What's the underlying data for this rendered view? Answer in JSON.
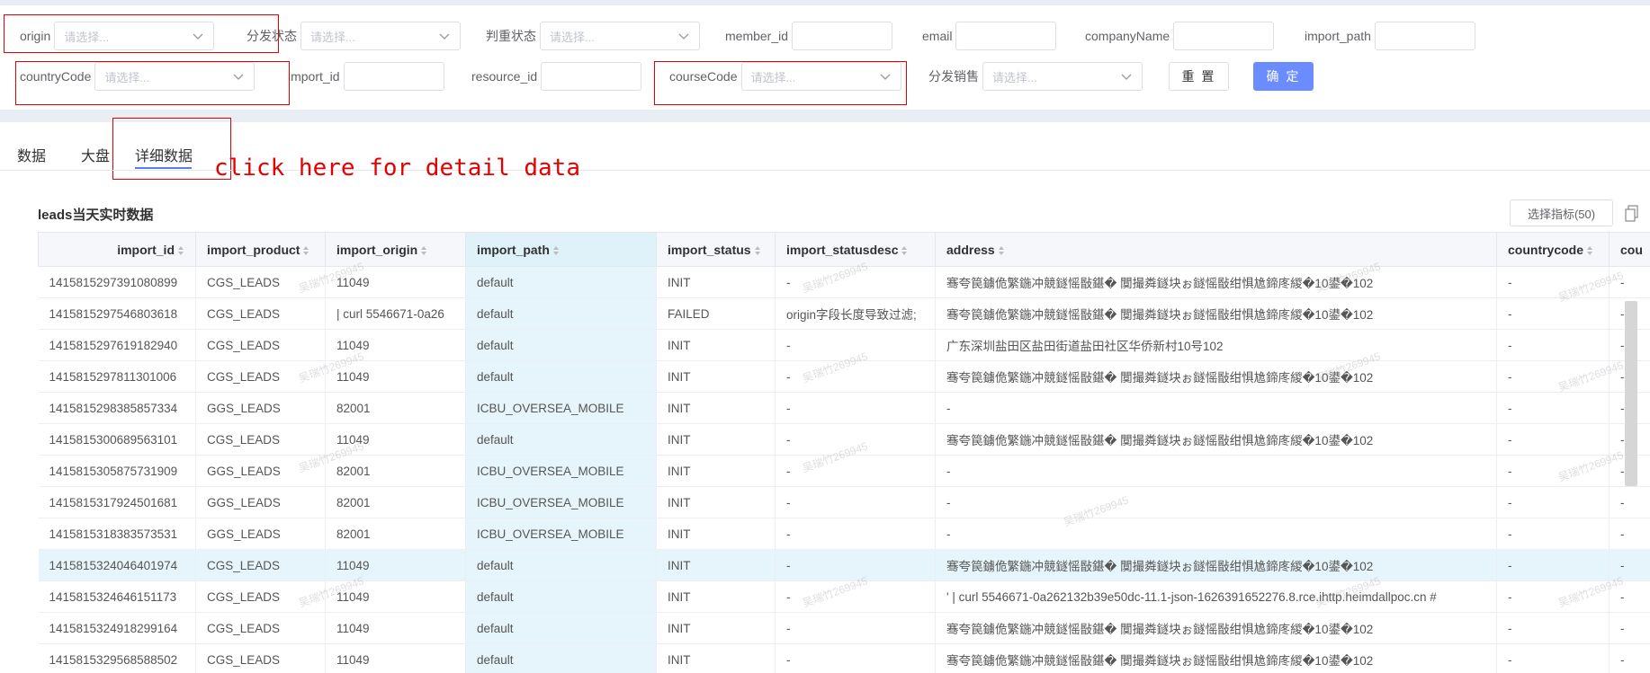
{
  "filters": {
    "origin": {
      "label": "origin",
      "placeholder": "请选择..."
    },
    "dispatch_status": {
      "label": "分发状态",
      "placeholder": "请选择..."
    },
    "judge_status": {
      "label": "判重状态",
      "placeholder": "请选择..."
    },
    "member_id": {
      "label": "member_id",
      "value": ""
    },
    "email": {
      "label": "email",
      "value": ""
    },
    "companyName": {
      "label": "companyName",
      "value": ""
    },
    "import_path": {
      "label": "import_path",
      "value": ""
    },
    "countryCode": {
      "label": "countryCode",
      "placeholder": "请选择..."
    },
    "import_id": {
      "label": "import_id",
      "value": ""
    },
    "resource_id": {
      "label": "resource_id",
      "value": ""
    },
    "courseCode": {
      "label": "courseCode",
      "placeholder": "请选择..."
    },
    "dispatch_sales": {
      "label": "分发销售",
      "placeholder": "请选择..."
    },
    "reset_label": "重 置",
    "confirm_label": "确 定"
  },
  "tabs": [
    {
      "label": "数据"
    },
    {
      "label": "大盘"
    },
    {
      "label": "详细数据",
      "active": true
    }
  ],
  "annotation": "click here for detail data",
  "table": {
    "title": "leads当天实时数据",
    "select_metrics_label": "选择指标(50)",
    "columns": [
      "import_id",
      "import_product",
      "import_origin",
      "import_path",
      "import_status",
      "import_statusdesc",
      "address",
      "countrycode",
      "cou"
    ],
    "rows": [
      [
        "1415815297391080899",
        "CGS_LEADS",
        "11049",
        "default",
        "INIT",
        "-",
        "骞夸笢鐪佹繁鍦冲競鐩愮敯鍖�    闃撮粦鐩块ぉ鐩愮敯绀惧尯鍗庝緵�10鍙�102",
        "-",
        "-"
      ],
      [
        "1415815297546803618",
        "CGS_LEADS",
        "| curl 5546671-0a26",
        "default",
        "FAILED",
        "origin字段长度导致过滤;",
        "骞夸笢鐪佹繁鍦冲競鐩愮敯鍖�    闃撮粦鐩块ぉ鐩愮敯绀惧尯鍗庝緵�10鍙�102",
        "-",
        "-"
      ],
      [
        "1415815297619182940",
        "CGS_LEADS",
        "11049",
        "default",
        "INIT",
        "-",
        "广东深圳盐田区盐田街道盐田社区华侨新村10号102",
        "-",
        "-"
      ],
      [
        "1415815297811301006",
        "CGS_LEADS",
        "11049",
        "default",
        "INIT",
        "-",
        "骞夸笢鐪佹繁鍦冲競鐩愮敯鍖�    闃撮粦鐩块ぉ鐩愮敯绀惧尯鍗庝緵�10鍙�102",
        "-",
        "-"
      ],
      [
        "1415815298385857334",
        "GGS_LEADS",
        "82001",
        "ICBU_OVERSEA_MOBILE",
        "INIT",
        "-",
        "-",
        "-",
        "-"
      ],
      [
        "1415815300689563101",
        "CGS_LEADS",
        "11049",
        "default",
        "INIT",
        "-",
        "骞夸笢鐪佹繁鍦冲競鐩愮敯鍖�    闃撮粦鐩块ぉ鐩愮敯绀惧尯鍗庝緵�10鍙�102",
        "-",
        "-"
      ],
      [
        "1415815305875731909",
        "GGS_LEADS",
        "82001",
        "ICBU_OVERSEA_MOBILE",
        "INIT",
        "-",
        "-",
        "-",
        "-"
      ],
      [
        "1415815317924501681",
        "GGS_LEADS",
        "82001",
        "ICBU_OVERSEA_MOBILE",
        "INIT",
        "-",
        "-",
        "-",
        "-"
      ],
      [
        "1415815318383573531",
        "GGS_LEADS",
        "82001",
        "ICBU_OVERSEA_MOBILE",
        "INIT",
        "-",
        "-",
        "-",
        "-"
      ],
      [
        "1415815324046401974",
        "CGS_LEADS",
        "11049",
        "default",
        "INIT",
        "-",
        "骞夸笢鐪佹繁鍦冲競鐩愮敯鍖�    闃撮粦鐩块ぉ鐩愮敯绀惧尯鍗庝緵�10鍙�102",
        "-",
        "-"
      ],
      [
        "1415815324646151173",
        "CGS_LEADS",
        "11049",
        "default",
        "INIT",
        "-",
        "' | curl 5546671-0a262132b39e50dc-11.1-json-1626391652276.8.rce.ihttp.heimdallpoc.cn #",
        "-",
        "-"
      ],
      [
        "1415815324918299164",
        "CGS_LEADS",
        "11049",
        "default",
        "INIT",
        "-",
        "骞夸笢鐪佹繁鍦冲競鐩愮敯鍖�    闃撮粦鐩块ぉ鐩愮敯绀惧尯鍗庝緵�10鍙�102",
        "-",
        "-"
      ],
      [
        "1415815329568588502",
        "CGS_LEADS",
        "11049",
        "default",
        "INIT",
        "-",
        "骞夸笢鐪佹繁鍦冲競鐩愮敯鍖�    闃撮粦鐩块ぉ鐩愮敯绀惧尯鍗庝緵�10鍙�102",
        "-",
        "-"
      ]
    ],
    "highlighted_row": 9
  },
  "watermark": "吴瑞竹269945",
  "colors": {
    "accent": "#5b7cf0",
    "confirm": "#6b8cff",
    "annotation": "#e60000",
    "highlight": "#e6f5fb"
  }
}
